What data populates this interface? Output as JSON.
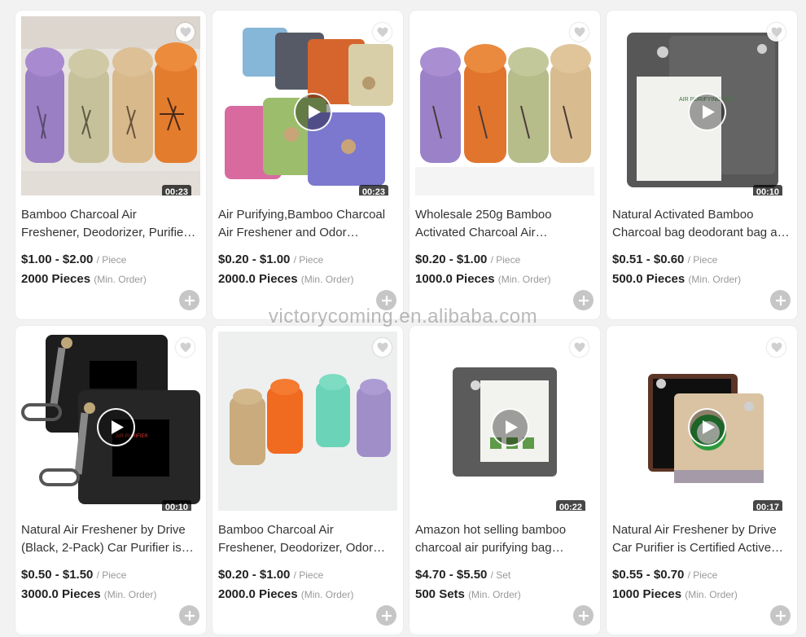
{
  "watermark": "victorycoming.en.alibaba.com",
  "colors": {
    "add_button": "#c6c6c6",
    "price_unit": "#999999"
  },
  "products": [
    {
      "title_line1": "Bamboo Charcoal Air",
      "title_line2": "Freshener, Deodorizer, Purifier…",
      "price": "$1.00 - $2.00",
      "unit": "/ Piece",
      "moq": "2000 Pieces",
      "moq_note": "(Min. Order)",
      "duration": "00:23",
      "has_play": false
    },
    {
      "title_line1": "Air Purifying,Bamboo Charcoal",
      "title_line2": "Air Freshener and Odor…",
      "price": "$0.20 - $1.00",
      "unit": "/ Piece",
      "moq": "2000.0 Pieces",
      "moq_note": "(Min. Order)",
      "duration": "00:23",
      "has_play": true
    },
    {
      "title_line1": "Wholesale 250g Bamboo",
      "title_line2": "Activated Charcoal Air…",
      "price": "$0.20 - $1.00",
      "unit": "/ Piece",
      "moq": "1000.0 Pieces",
      "moq_note": "(Min. Order)",
      "duration": "",
      "has_play": false
    },
    {
      "title_line1": "Natural Activated Bamboo",
      "title_line2": "Charcoal bag deodorant bag a…",
      "price": "$0.51 - $0.60",
      "unit": "/ Piece",
      "moq": "500.0 Pieces",
      "moq_note": "(Min. Order)",
      "duration": "00:10",
      "has_play": true
    },
    {
      "title_line1": "Natural Air Freshener by Drive",
      "title_line2": "(Black, 2-Pack) Car Purifier is…",
      "price": "$0.50 - $1.50",
      "unit": "/ Piece",
      "moq": "3000.0 Pieces",
      "moq_note": "(Min. Order)",
      "duration": "00:10",
      "has_play": true
    },
    {
      "title_line1": "Bamboo Charcoal Air",
      "title_line2": "Freshener, Deodorizer, Odor…",
      "price": "$0.20 - $1.00",
      "unit": "/ Piece",
      "moq": "2000.0 Pieces",
      "moq_note": "(Min. Order)",
      "duration": "",
      "has_play": false
    },
    {
      "title_line1": "Amazon hot selling bamboo",
      "title_line2": "charcoal air purifying bag…",
      "price": "$4.70 - $5.50",
      "unit": "/ Set",
      "moq": "500 Sets",
      "moq_note": "(Min. Order)",
      "duration": "00:22",
      "has_play": true
    },
    {
      "title_line1": "Natural Air Freshener by Drive",
      "title_line2": "Car Purifier is Certified Active…",
      "price": "$0.55 - $0.70",
      "unit": "/ Piece",
      "moq": "1000 Pieces",
      "moq_note": "(Min. Order)",
      "duration": "00:17",
      "has_play": true
    }
  ]
}
